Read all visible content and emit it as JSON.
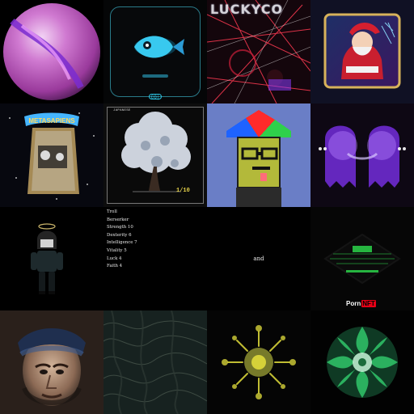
{
  "tiles": [
    {
      "id": "marble-orb",
      "kind": "artwork"
    },
    {
      "id": "fish-card",
      "kind": "artwork",
      "badge": "CO|"
    },
    {
      "id": "lucky-lines",
      "kind": "artwork",
      "title": "LUCKYCO"
    },
    {
      "id": "santa-card",
      "kind": "artwork"
    },
    {
      "id": "metasapiens",
      "kind": "artwork",
      "title": "METASAPIENS"
    },
    {
      "id": "snow-tree",
      "kind": "artwork",
      "label": "JAPANESE",
      "edition": "1/10"
    },
    {
      "id": "pixel-character",
      "kind": "artwork"
    },
    {
      "id": "purple-ghosts",
      "kind": "artwork"
    },
    {
      "id": "doll-figure",
      "kind": "artwork"
    },
    {
      "id": "character-stats",
      "kind": "text"
    },
    {
      "id": "and-text",
      "kind": "text"
    },
    {
      "id": "porn-nft",
      "kind": "artwork"
    },
    {
      "id": "bandana-portrait",
      "kind": "artwork"
    },
    {
      "id": "marble-texture",
      "kind": "artwork"
    },
    {
      "id": "yellow-mandala",
      "kind": "artwork"
    },
    {
      "id": "green-mandala",
      "kind": "artwork"
    }
  ],
  "stats": {
    "race": "Troll",
    "class": "Berserker",
    "lines": [
      "Strength 10",
      "Dexterity 6",
      "Intelligence 7",
      "Vitality 5",
      "Luck 4",
      "Faith 4"
    ]
  },
  "and_text": "and",
  "porn_nft": {
    "left": "Porn",
    "right": "NFT"
  },
  "colors": {
    "orb": "#c466c6",
    "fish": "#38c9ef",
    "lucky_lines": "#ff3a52",
    "pixel_bg": "#6a7ec6",
    "ghost": "#a44dff",
    "porn_red": "#e60016",
    "mandala_yellow": "#d5d139",
    "mandala_green": "#31c66a"
  }
}
